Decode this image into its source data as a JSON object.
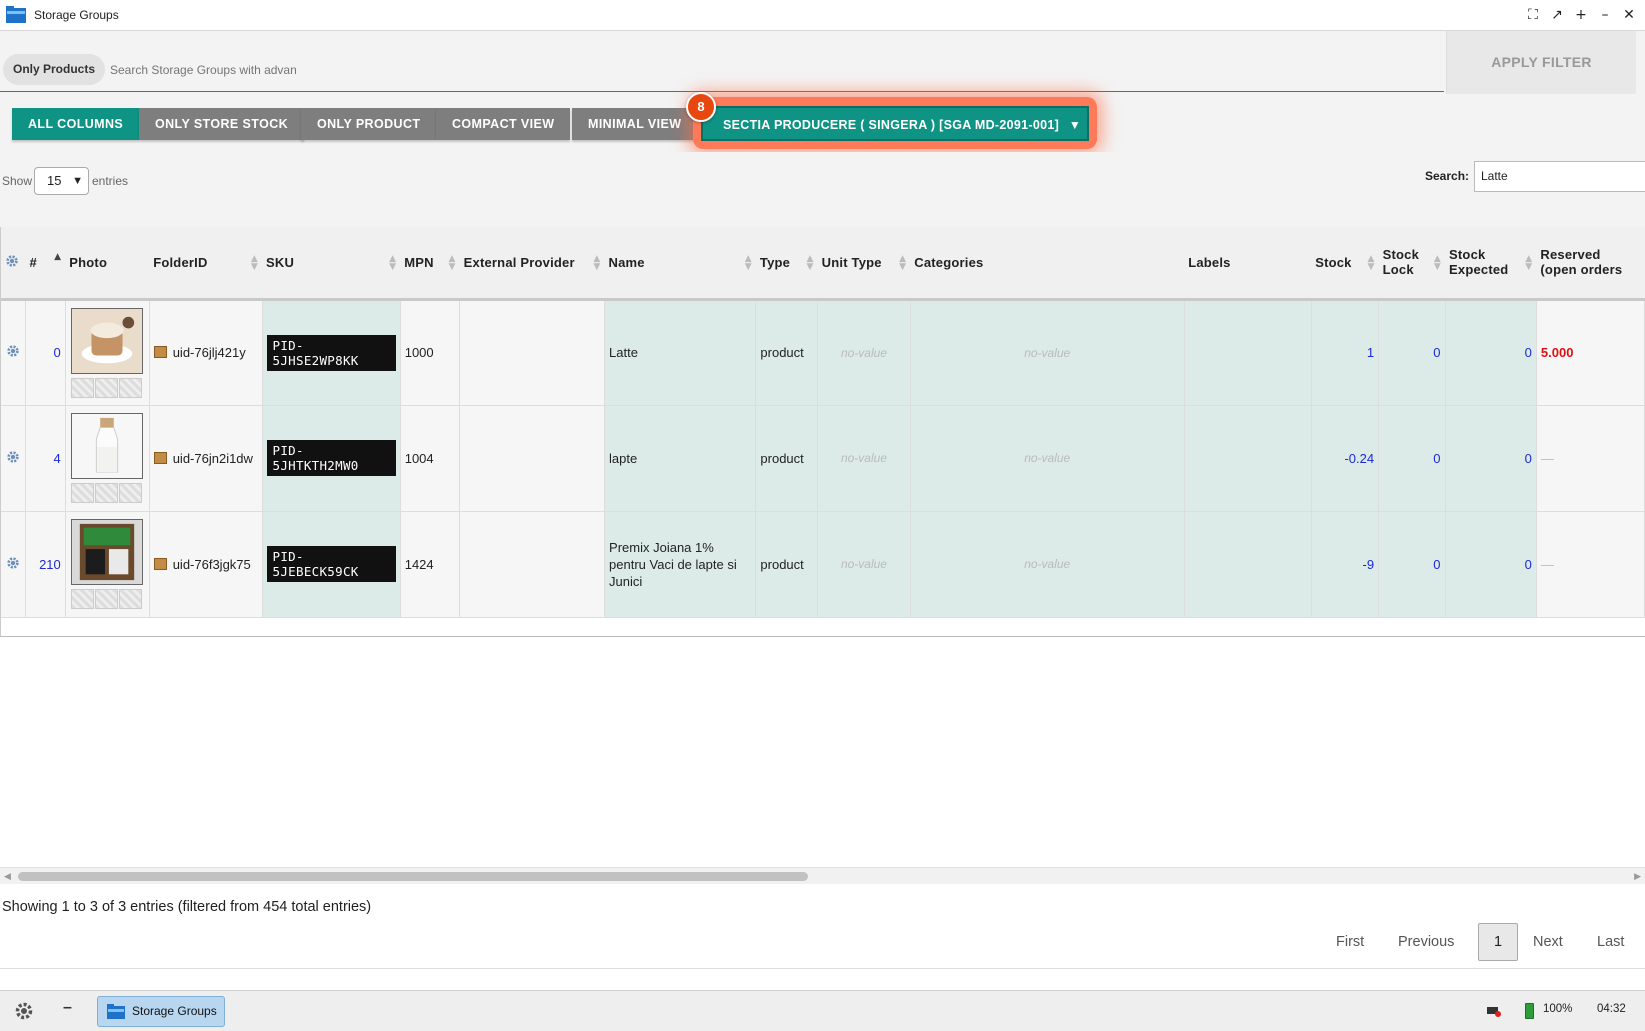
{
  "window": {
    "title": "Storage Groups",
    "controls": [
      "⛶",
      "↗",
      "+",
      "–",
      "✕"
    ]
  },
  "filter": {
    "chip_label": "Only Products",
    "search_placeholder": "Search Storage Groups with advan",
    "apply_label": "APPLY FILTER"
  },
  "toolbar": {
    "buttons": [
      "ALL COLUMNS",
      "ONLY STORE STOCK",
      "ONLY PRODUCT",
      "COMPACT VIEW",
      "MINIMAL VIEW"
    ],
    "active_index": 0,
    "store_select": "SECTIA PRODUCERE ( SINGERA ) [SGA MD-2091-001]",
    "badge": "8"
  },
  "length": {
    "show_label": "Show",
    "value": "15",
    "entries_label": "entries"
  },
  "search": {
    "label": "Search:",
    "value": "Latte"
  },
  "table": {
    "columns": [
      "#",
      "Photo",
      "FolderID",
      "SKU",
      "MPN",
      "External Provider",
      "Name",
      "Type",
      "Unit Type",
      "Categories",
      "Labels",
      "Stock",
      "Stock Lock",
      "Stock Expected",
      "Reserved (open orders"
    ],
    "rows": [
      {
        "idx": "0",
        "folder": "uid-76jlj421y",
        "sku": "PID-5JHSE2WP8KK",
        "mpn": "1000",
        "provider": "",
        "name": "Latte",
        "type": "product",
        "unit_type": "no-value",
        "categories": "no-value",
        "labels": "",
        "stock": "1",
        "stock_lock": "0",
        "stock_expected": "0",
        "reserved": "5.000"
      },
      {
        "idx": "4",
        "folder": "uid-76jn2i1dw",
        "sku": "PID-5JHTKTH2MW0",
        "mpn": "1004",
        "provider": "",
        "name": "lapte",
        "type": "product",
        "unit_type": "no-value",
        "categories": "no-value",
        "labels": "",
        "stock": "-0.24",
        "stock_lock": "0",
        "stock_expected": "0",
        "reserved": "—"
      },
      {
        "idx": "210",
        "folder": "uid-76f3jgk75",
        "sku": "PID-5JEBECK59CK",
        "mpn": "1424",
        "provider": "",
        "name": "Premix Joiana 1% pentru Vaci de lapte si Junici",
        "type": "product",
        "unit_type": "no-value",
        "categories": "no-value",
        "labels": "",
        "stock": "-9",
        "stock_lock": "0",
        "stock_expected": "0",
        "reserved": "—"
      }
    ]
  },
  "footer": {
    "info": "Showing 1 to 3 of 3 entries (filtered from 454 total entries)",
    "first": "First",
    "previous": "Previous",
    "current": "1",
    "next": "Next",
    "last": "Last"
  },
  "taskbar": {
    "task_label": "Storage Groups",
    "battery": "100%",
    "time": "04:32"
  },
  "colors": {
    "accent": "#0e9384",
    "highlight": "#ff7a59",
    "badge": "#e8470f",
    "link_blue": "#1a2ad6",
    "reserved_red": "#e01010"
  }
}
